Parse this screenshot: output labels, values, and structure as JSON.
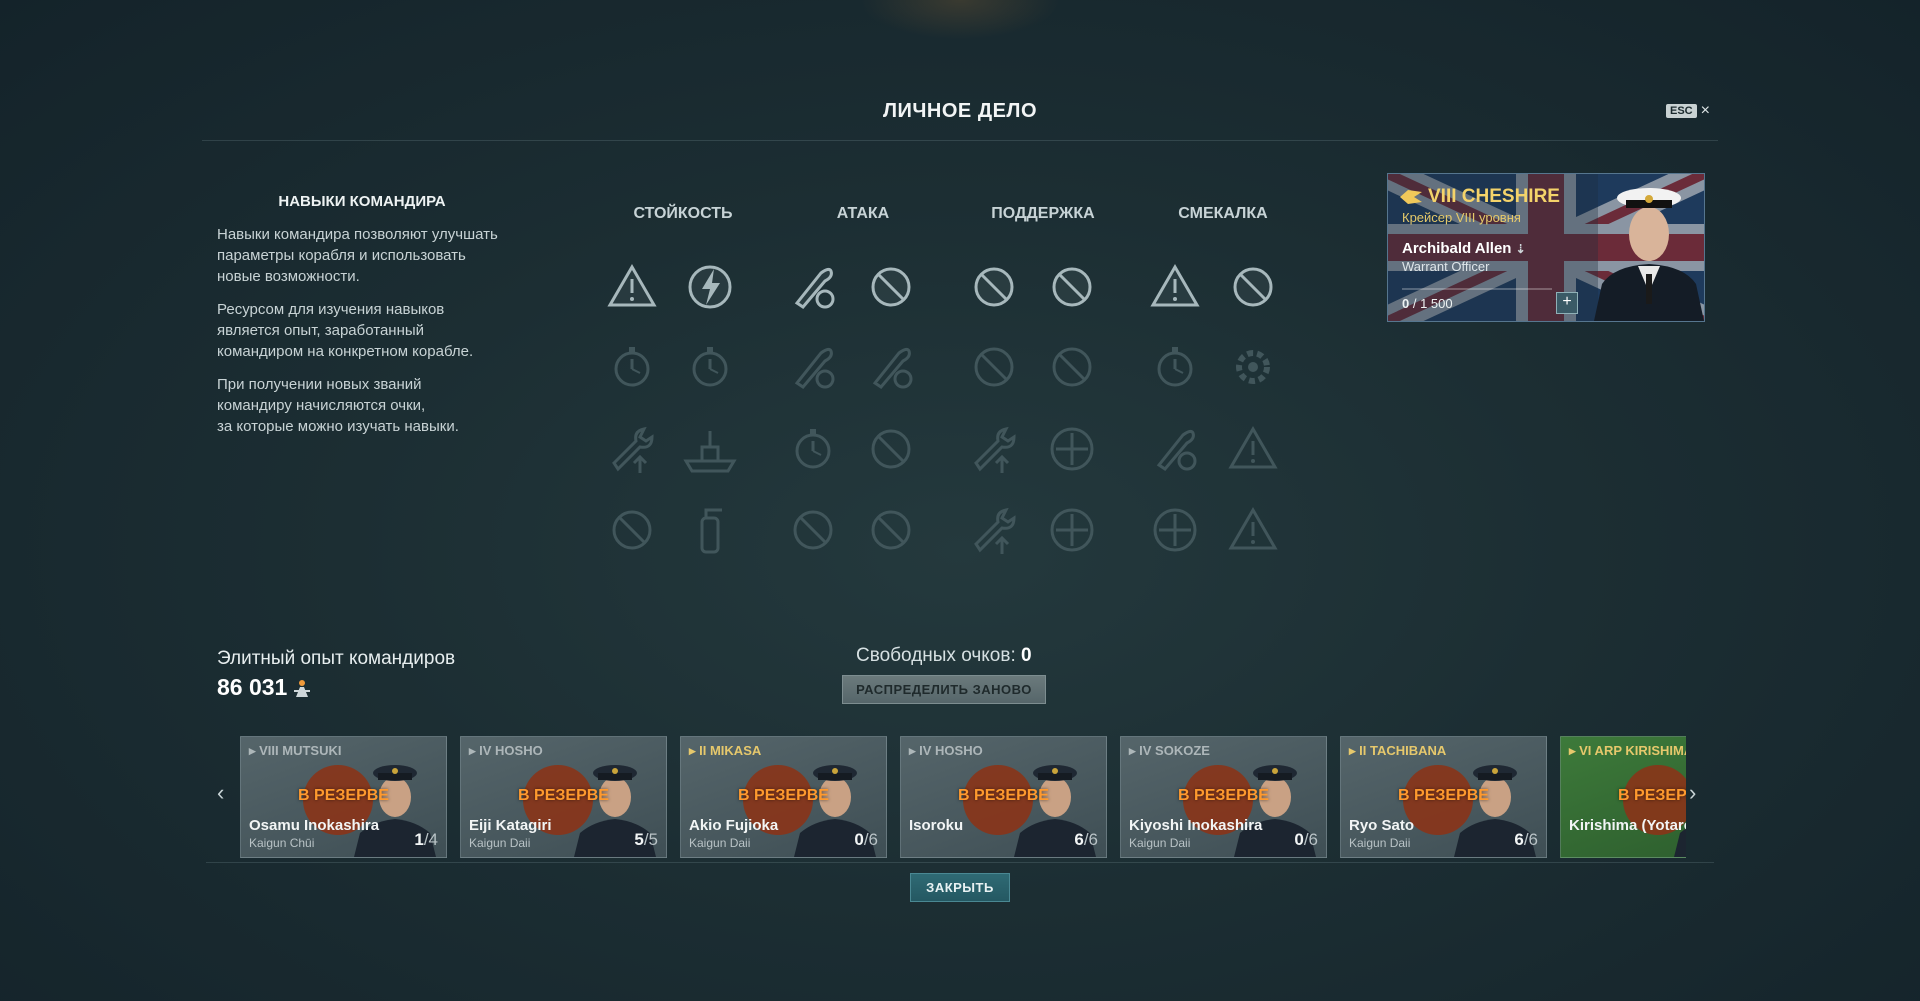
{
  "dialog": {
    "title": "ЛИЧНОЕ ДЕЛО",
    "esc_label": "ESC",
    "close_symbol": "×"
  },
  "left_panel": {
    "heading": "НАВЫКИ КОМАНДИРА",
    "p1_l1": "Навыки командира позволяют улучшать",
    "p1_l2": "параметры корабля и использовать",
    "p1_l3": "новые возможности.",
    "p2_l1": "Ресурсом для изучения навыков",
    "p2_l2": "является опыт, заработанный",
    "p2_l3": "командиром на конкретном корабле.",
    "p3_l1": "При получении новых званий",
    "p3_l2": "командиру начисляются очки,",
    "p3_l3": "за которые можно изучать навыки."
  },
  "skills": {
    "columns": [
      "СТОЙКОСТЬ",
      "АТАКА",
      "ПОДДЕРЖКА",
      "СМЕКАЛКА"
    ],
    "icons": [
      [
        "warning-clock-icon",
        "lightning-shield-icon",
        "torpedo-reticle-icon",
        "unavailable-icon",
        "unavailable-icon",
        "unavailable-icon",
        "shell-warning-icon",
        "unavailable-icon"
      ],
      [
        "wrench-timer-icon",
        "stopwatch-icon",
        "shell-hand-icon",
        "shell-arrow-icon",
        "unavailable-icon",
        "unavailable-icon",
        "shells-timer-icon",
        "gear-flower-icon"
      ],
      [
        "wrench-up-icon",
        "ship-fire-icon",
        "shell-timer-icon",
        "unavailable-icon",
        "repair-up-icon",
        "heal-plus-icon",
        "shells-fire-icon",
        "warning-up-icon"
      ],
      [
        "unavailable-icon",
        "extinguisher-icon",
        "unavailable-icon",
        "unavailable-icon",
        "repair-up-double-icon",
        "reticle-up-icon",
        "radar-icon",
        "warning-down-icon"
      ]
    ],
    "active": [
      [
        true,
        true,
        true,
        true,
        true,
        true,
        true,
        true
      ],
      [
        false,
        false,
        false,
        false,
        false,
        false,
        false,
        false
      ],
      [
        false,
        false,
        false,
        false,
        false,
        false,
        false,
        false
      ],
      [
        false,
        false,
        false,
        false,
        false,
        false,
        false,
        false
      ]
    ]
  },
  "commander_card": {
    "ship": "VIII CHESHIRE",
    "ship_class": "Крейсер VIII уровня",
    "name": "Archibald Allen",
    "rank": "Warrant Officer",
    "xp_current": "0",
    "xp_total": " / 1 500",
    "add_label": "+"
  },
  "elite": {
    "label": "Элитный опыт командиров",
    "value": "86 031"
  },
  "free_points": {
    "label": "Свободных очков: ",
    "value": "0"
  },
  "buttons": {
    "redistribute": "РАСПРЕДЕЛИТЬ ЗАНОВО",
    "close": "ЗАКРЫТЬ"
  },
  "carousel": {
    "prev": "‹",
    "next": "›",
    "commanders": [
      {
        "ship": "VIII MUTSUKI",
        "status": "В РЕЗЕРВЕ",
        "name": "Osamu Inokashira",
        "rank": "Kaigun Chūi",
        "count": "1",
        "max": "/4",
        "gold": false
      },
      {
        "ship": "IV HOSHO",
        "status": "В РЕЗЕРВЕ",
        "name": "Eiji Katagiri",
        "rank": "Kaigun Daii",
        "count": "5",
        "max": "/5",
        "gold": false
      },
      {
        "ship": "II MIKASA",
        "status": "В РЕЗЕРВЕ",
        "name": "Akio Fujioka",
        "rank": "Kaigun Daii",
        "count": "0",
        "max": "/6",
        "gold": true
      },
      {
        "ship": "IV HOSHO",
        "status": "В РЕЗЕРВЕ",
        "name": "Isoroku",
        "rank": "",
        "count": "6",
        "max": "/6",
        "gold": false
      },
      {
        "ship": "IV SOKOZE",
        "status": "В РЕЗЕРВЕ",
        "name": "Kiyoshi Inokashira",
        "rank": "Kaigun Daii",
        "count": "0",
        "max": "/6",
        "gold": false
      },
      {
        "ship": "II TACHIBANA",
        "status": "В РЕЗЕРВЕ",
        "name": "Ryo Sato",
        "rank": "Kaigun Daii",
        "count": "6",
        "max": "/6",
        "gold": true
      },
      {
        "ship": "VI ARP KIRISHIMA",
        "status": "В РЕЗЕРВЕ",
        "name": "Kirishima (Yotaro",
        "rank": "",
        "count": "",
        "max": "",
        "gold": true
      }
    ]
  }
}
